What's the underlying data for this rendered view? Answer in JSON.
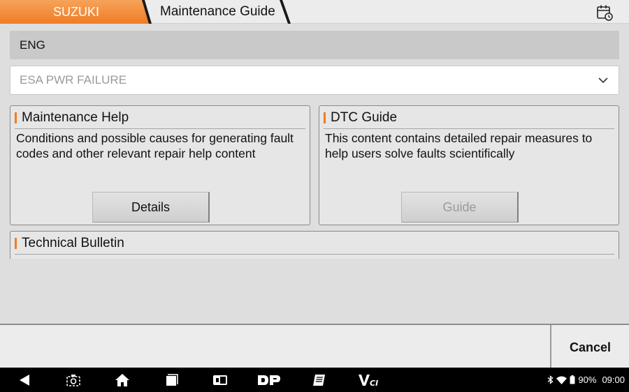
{
  "header": {
    "brand": "SUZUKI",
    "page_title": "Maintenance Guide"
  },
  "system": {
    "label": "ENG"
  },
  "dtc_select": {
    "value": "ESA PWR FAILURE"
  },
  "cards": {
    "maintenance_help": {
      "title": "Maintenance Help",
      "body": "Conditions and possible causes for generating fault codes and other relevant repair help content",
      "button": "Details"
    },
    "dtc_guide": {
      "title": "DTC Guide",
      "body": "This content contains detailed repair measures to help users solve faults scientifically",
      "button": "Guide"
    },
    "technical_bulletin": {
      "title": "Technical Bulletin"
    }
  },
  "footer": {
    "cancel": "Cancel"
  },
  "status_bar": {
    "battery": "90%",
    "time": "09:00"
  },
  "colors": {
    "accent": "#ef7c25",
    "panel": "#dedede",
    "navbar": "#000000"
  },
  "icons": [
    "calendar-clock-icon",
    "chevron-down-icon",
    "back-icon",
    "screenshot-icon",
    "home-icon",
    "recent-apps-icon",
    "vehicle-icon",
    "dp-icon",
    "manual-icon",
    "vci-icon",
    "bluetooth-icon",
    "wifi-icon",
    "battery-icon"
  ]
}
